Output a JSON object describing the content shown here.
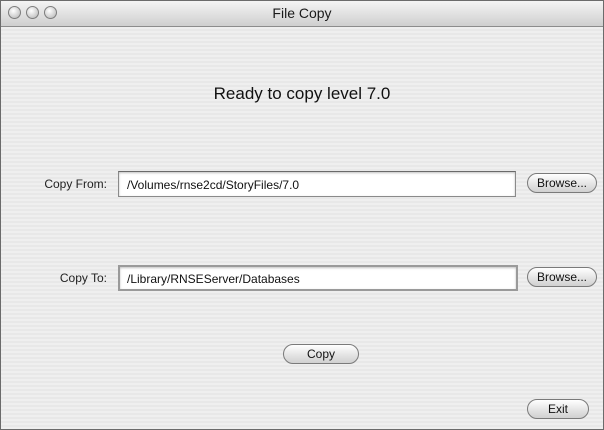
{
  "window": {
    "title": "File Copy"
  },
  "heading": "Ready to copy level 7.0",
  "copy_from": {
    "label": "Copy From:",
    "value": "/Volumes/rnse2cd/StoryFiles/7.0",
    "browse_label": "Browse..."
  },
  "copy_to": {
    "label": "Copy To:",
    "value": "/Library/RNSEServer/Databases",
    "browse_label": "Browse..."
  },
  "actions": {
    "copy_label": "Copy",
    "exit_label": "Exit"
  }
}
